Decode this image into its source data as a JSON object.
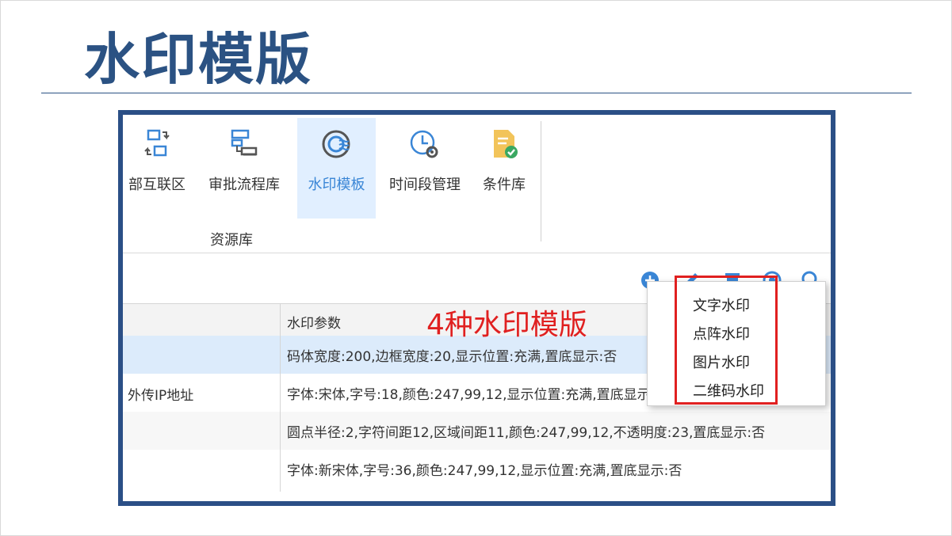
{
  "slide": {
    "title": "水印模版"
  },
  "ribbon": {
    "buttons": [
      {
        "label": "部互联区",
        "icon": "network-transfer-icon"
      },
      {
        "label": "审批流程库",
        "icon": "flowchart-icon"
      },
      {
        "label": "水印模板",
        "icon": "watermark-icon",
        "active": true
      },
      {
        "label": "时间段管理",
        "icon": "clock-gear-icon"
      },
      {
        "label": "条件库",
        "icon": "document-check-icon"
      }
    ],
    "group_label": "资源库"
  },
  "toolbar": {
    "icons": [
      "add-icon",
      "edit-icon",
      "delete-icon",
      "copy-icon",
      "search-icon"
    ]
  },
  "table": {
    "header_param": "水印参数",
    "rows": [
      {
        "name": "",
        "params": "码体宽度:200,边框宽度:20,显示位置:充满,置底显示:否"
      },
      {
        "name": "外传IP地址",
        "params": "字体:宋体,字号:18,颜色:247,99,12,显示位置:充满,置底显示:否"
      },
      {
        "name": "",
        "params": "圆点半径:2,字符间距12,区域间距11,颜色:247,99,12,不透明度:23,置底显示:否"
      },
      {
        "name": "",
        "params": "字体:新宋体,字号:36,颜色:247,99,12,显示位置:充满,置底显示:否"
      }
    ]
  },
  "annotation": "4种水印模版",
  "menu": {
    "items": [
      "文字水印",
      "点阵水印",
      "图片水印",
      "二维码水印"
    ]
  },
  "colors": {
    "title": "#2b5283",
    "frame": "#2b4f86",
    "annotation": "#e02020",
    "accent": "#3a86d6"
  }
}
